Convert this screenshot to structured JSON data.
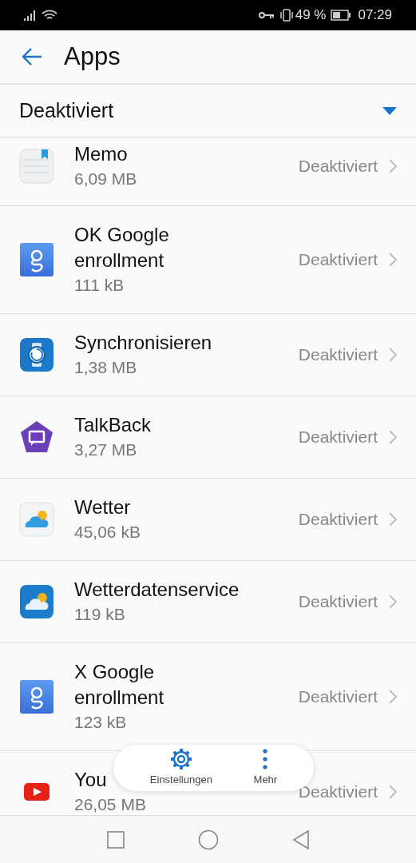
{
  "status_bar": {
    "battery_percent": "49 %",
    "time": "07:29"
  },
  "header": {
    "title": "Apps"
  },
  "filter": {
    "label": "Deaktiviert"
  },
  "apps": [
    {
      "name": "Memo",
      "size": "6,09 MB",
      "status": "Deaktiviert",
      "kind": "memo"
    },
    {
      "name": "OK Google enrollment",
      "size": "111 kB",
      "status": "Deaktiviert",
      "kind": "google"
    },
    {
      "name": "Synchronisieren",
      "size": "1,38 MB",
      "status": "Deaktiviert",
      "kind": "watch"
    },
    {
      "name": "TalkBack",
      "size": "3,27 MB",
      "status": "Deaktiviert",
      "kind": "talkback"
    },
    {
      "name": "Wetter",
      "size": "45,06 kB",
      "status": "Deaktiviert",
      "kind": "weather"
    },
    {
      "name": "Wetterdatenservice",
      "size": "119 kB",
      "status": "Deaktiviert",
      "kind": "weather_service"
    },
    {
      "name": "X Google enrollment",
      "size": "123 kB",
      "status": "Deaktiviert",
      "kind": "google"
    },
    {
      "name": "You",
      "size": "26,05 MB",
      "status": "Deaktiviert",
      "kind": "youtube"
    }
  ],
  "bottom_actions": [
    {
      "label": "Einstellungen",
      "kind": "gear"
    },
    {
      "label": "Mehr",
      "kind": "more"
    }
  ]
}
